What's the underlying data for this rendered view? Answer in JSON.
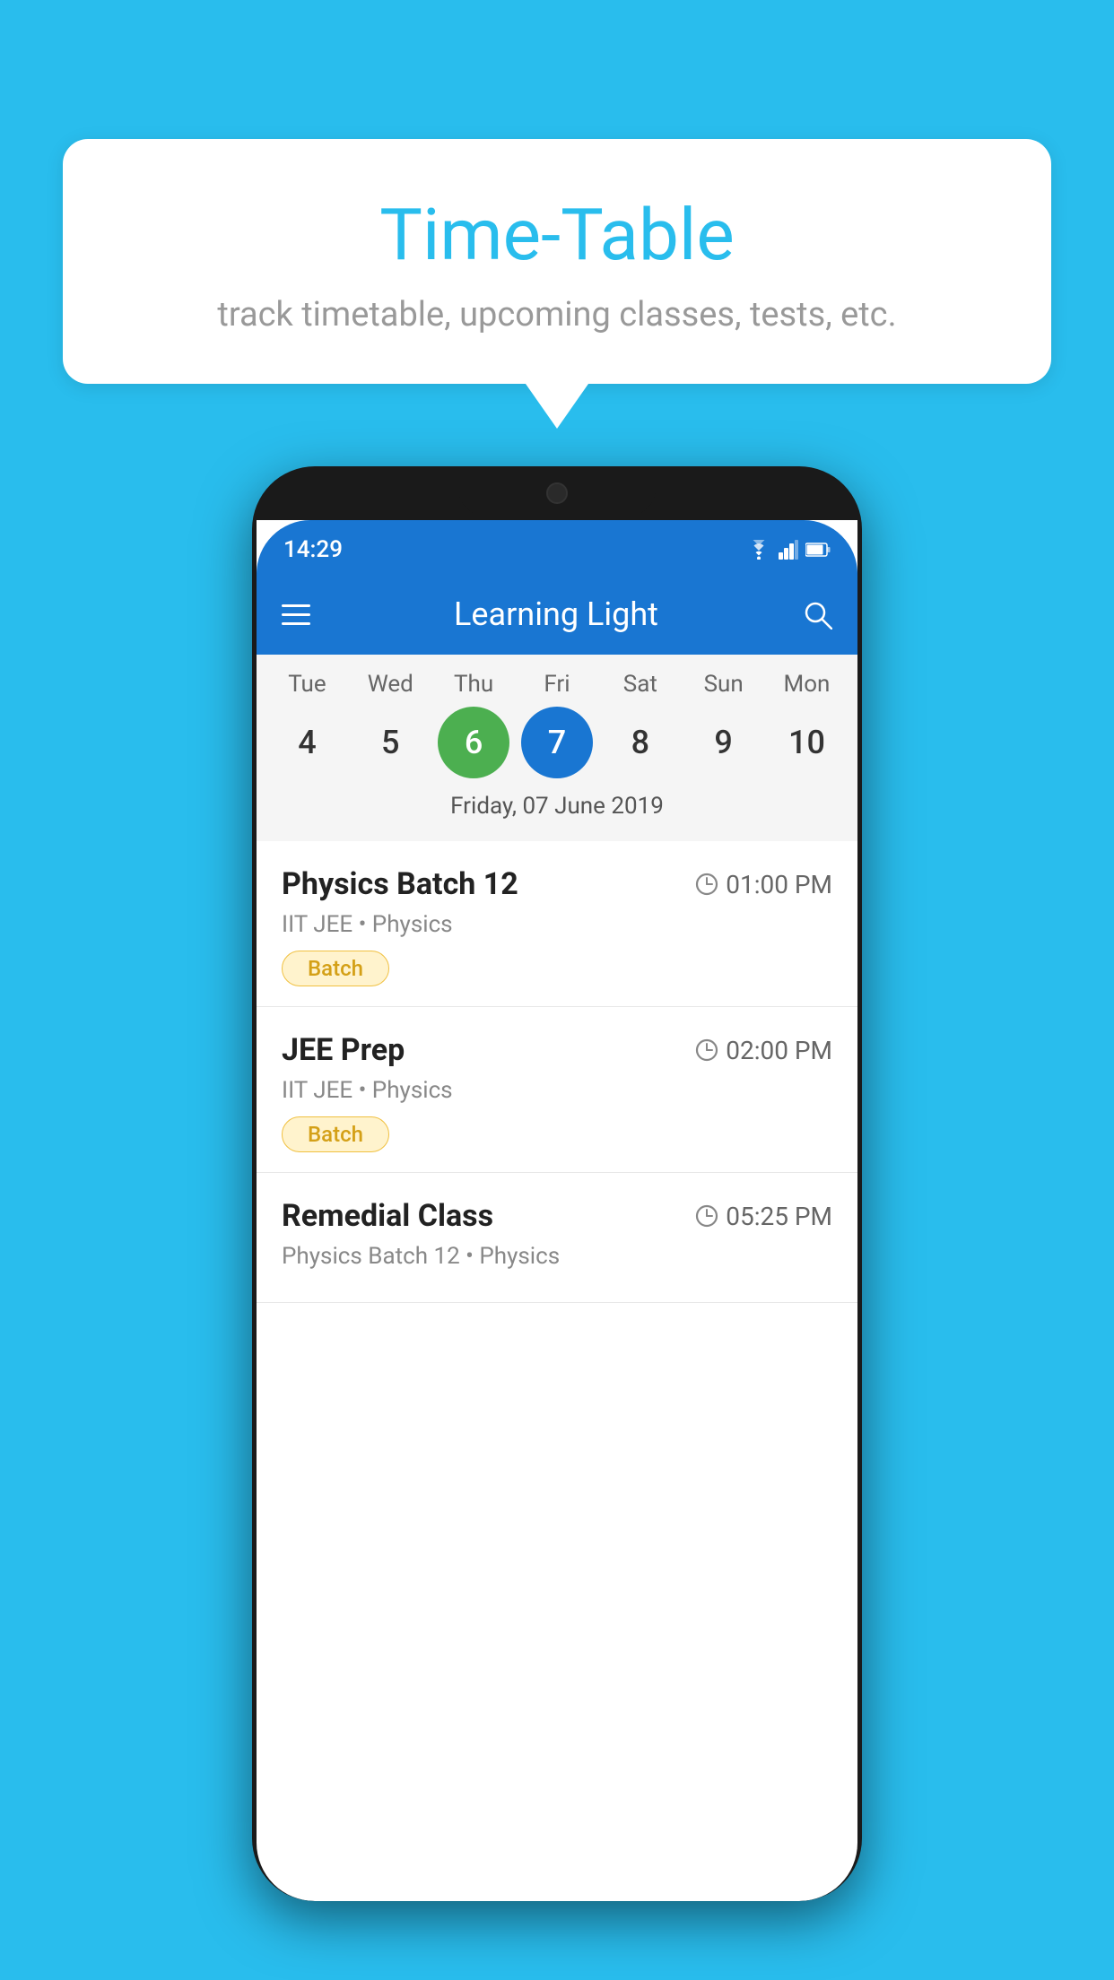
{
  "background_color": "#29BDED",
  "bubble": {
    "title": "Time-Table",
    "subtitle": "track timetable, upcoming classes, tests, etc."
  },
  "phone": {
    "status_bar": {
      "time": "14:29"
    },
    "app_bar": {
      "title": "Learning Light"
    },
    "calendar": {
      "days": [
        {
          "label": "Tue",
          "number": "4"
        },
        {
          "label": "Wed",
          "number": "5"
        },
        {
          "label": "Thu",
          "number": "6",
          "state": "today"
        },
        {
          "label": "Fri",
          "number": "7",
          "state": "selected"
        },
        {
          "label": "Sat",
          "number": "8"
        },
        {
          "label": "Sun",
          "number": "9"
        },
        {
          "label": "Mon",
          "number": "10"
        }
      ],
      "selected_date": "Friday, 07 June 2019"
    },
    "schedule": [
      {
        "title": "Physics Batch 12",
        "time": "01:00 PM",
        "subtitle": "IIT JEE • Physics",
        "tag": "Batch"
      },
      {
        "title": "JEE Prep",
        "time": "02:00 PM",
        "subtitle": "IIT JEE • Physics",
        "tag": "Batch"
      },
      {
        "title": "Remedial Class",
        "time": "05:25 PM",
        "subtitle": "Physics Batch 12 • Physics",
        "tag": null
      }
    ]
  }
}
